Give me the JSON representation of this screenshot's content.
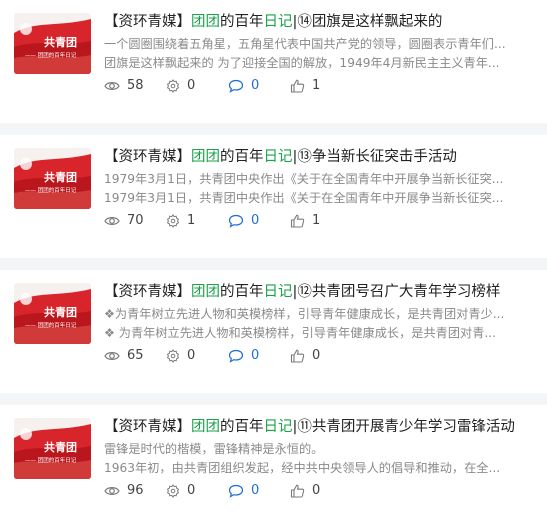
{
  "articles": [
    {
      "prefix": "【资环青媒】",
      "hl1": "团团",
      "mid": "的百年",
      "hl2": "日记",
      "rest": "|⑭团旗是这样飘起来的",
      "line1": "一个圆圈围绕着五角星，五角星代表中国共产党的领导，圆圈表示青年们...",
      "line2": "团旗是这样飘起来的 为了迎接全国的解放，1949年4月新民主主义青年...",
      "views": "58",
      "likes_a": "0",
      "comments": "0",
      "likes_b": "1"
    },
    {
      "prefix": "【资环青媒】",
      "hl1": "团团",
      "mid": "的百年",
      "hl2": "日记",
      "rest": "|⑬争当新长征突击手活动",
      "line1": "1979年3月1日，共青团中央作出《关于在全国青年中开展争当新长征突...",
      "line2": "1979年3月1日，共青团中央作出《关于在全国青年中开展争当新长征突...",
      "views": "70",
      "likes_a": "1",
      "comments": "0",
      "likes_b": "1"
    },
    {
      "prefix": "【资环青媒】",
      "hl1": "团团",
      "mid": "的百年",
      "hl2": "日记",
      "rest": "|⑫共青团号召广大青年学习榜样",
      "line1": "❖为青年树立先进人物和英模榜样，引导青年健康成长，是共青团对青少...",
      "line2": "❖ 为青年树立先进人物和英模榜样，引导青年健康成长，是共青团对青...",
      "views": "65",
      "likes_a": "0",
      "comments": "0",
      "likes_b": "0"
    },
    {
      "prefix": "【资环青媒】",
      "hl1": "团团",
      "mid": "的百年",
      "hl2": "日记",
      "rest": "|⑪共青团开展青少年学习雷锋活动",
      "line1": "雷锋是时代的楷模，雷锋精神是永恒的。",
      "line2": "1963年初，由共青团组织发起，经中共中央领导人的倡导和推动，在全...",
      "views": "96",
      "likes_a": "0",
      "comments": "0",
      "likes_b": "0"
    }
  ],
  "thumb": {
    "title": "共青团",
    "subtitle": "—— 团团的百年日记"
  },
  "icons": {
    "views": "eye-icon",
    "likes_a": "gear-icon",
    "comments": "comment-icon",
    "likes_b": "thumbs-up-icon"
  },
  "colors": {
    "highlight": "#1aa34a",
    "comment": "#1f6fd1",
    "summary": "#8a8a8a"
  }
}
